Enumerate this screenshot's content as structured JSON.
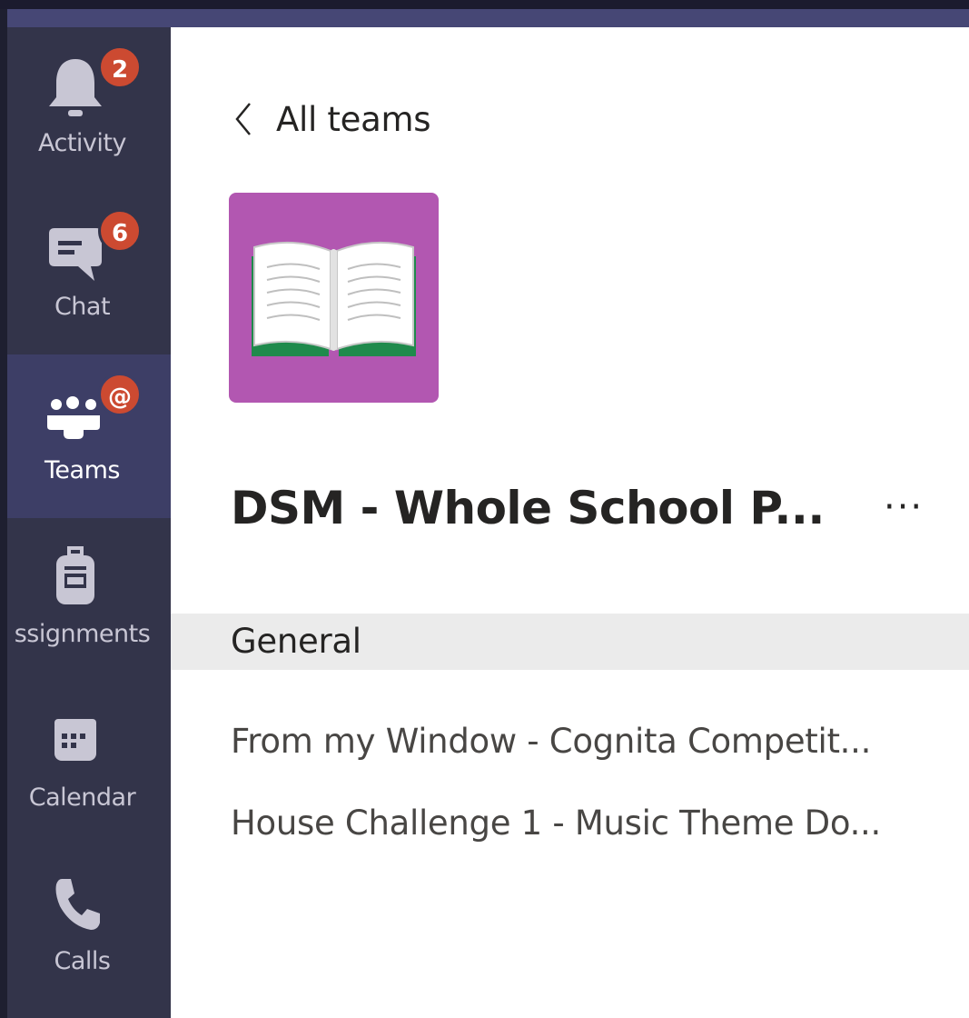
{
  "rail": {
    "items": [
      {
        "label": "Activity",
        "icon": "bell-icon",
        "badge": "2"
      },
      {
        "label": "Chat",
        "icon": "chat-icon",
        "badge": "6"
      },
      {
        "label": "Teams",
        "icon": "teams-icon",
        "badge": "@"
      },
      {
        "label": "ssignments",
        "icon": "assignments-icon",
        "badge": ""
      },
      {
        "label": "Calendar",
        "icon": "calendar-icon",
        "badge": ""
      },
      {
        "label": "Calls",
        "icon": "phone-icon",
        "badge": ""
      }
    ],
    "active": "Teams"
  },
  "main": {
    "back_label": "All teams",
    "team": {
      "name": "DSM - Whole School P...",
      "more": "···",
      "tile_color": "#b257b1",
      "tile_icon": "open-book-icon"
    },
    "channels": [
      {
        "label": "General",
        "selected": true
      },
      {
        "label": "From my Window - Cognita Competit...",
        "selected": false
      },
      {
        "label": "House Challenge 1 - Music Theme Do...",
        "selected": false
      }
    ]
  },
  "colors": {
    "rail_bg": "#33344a",
    "rail_active": "#3d3e66",
    "badge": "#cc4a31",
    "top_bar": "#464775",
    "selected_row": "#ebebeb"
  }
}
